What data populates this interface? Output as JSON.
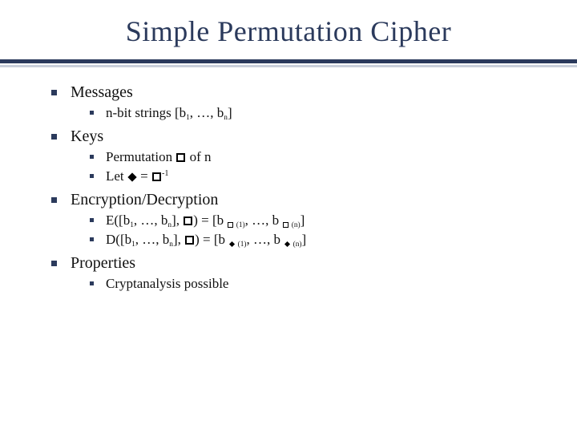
{
  "title": "Simple Permutation Cipher",
  "sections": {
    "messages": {
      "heading": "Messages",
      "item1_pre": "n-bit strings [b",
      "item1_sub1": "1",
      "item1_mid": ", …, b",
      "item1_sub2": "n",
      "item1_post": "]"
    },
    "keys": {
      "heading": "Keys",
      "item1_pre": "Permutation ",
      "item1_post": " of n",
      "item2_pre": "Let ",
      "item2_eq": " = ",
      "item2_sup": "-1"
    },
    "encdec": {
      "heading": "Encryption/Decryption",
      "e_pre": "E([b",
      "e_s1": "1",
      "e_mid1": ", …, b",
      "e_s2": "n",
      "e_mid2": "], ",
      "e_mid3": ") = [b ",
      "e_s3": " (1)",
      "e_mid4": ", …, b ",
      "e_s4": " (n)",
      "e_post": "]",
      "d_pre": "D([b",
      "d_s1": "1",
      "d_mid1": ", …, b",
      "d_s2": "n",
      "d_mid2": "], ",
      "d_mid3": ") = [b ",
      "d_s3": " (1)",
      "d_mid4": ", …, b ",
      "d_s4": " (n)",
      "d_post": "]"
    },
    "props": {
      "heading": "Properties",
      "item1": "Cryptanalysis possible"
    }
  }
}
